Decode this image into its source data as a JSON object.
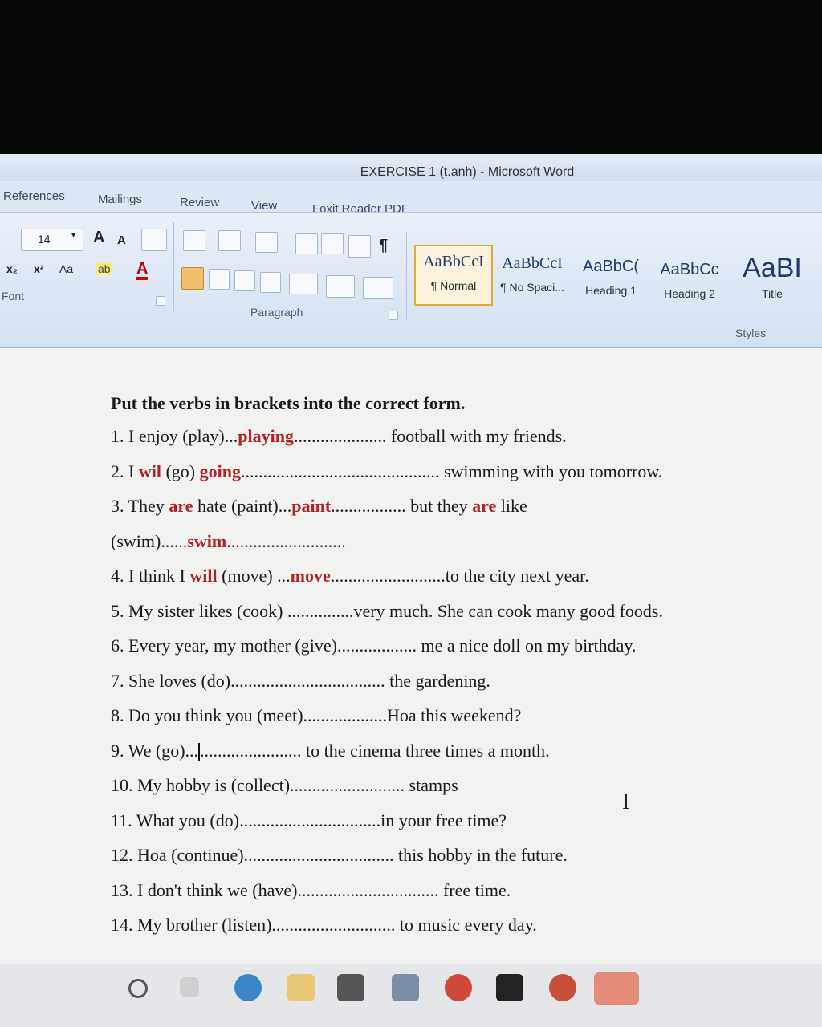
{
  "window": {
    "title": "EXERCISE 1 (t.anh) - Microsoft Word"
  },
  "tabs": [
    "References",
    "Mailings",
    "Review",
    "View",
    "Foxit Reader PDF"
  ],
  "ribbon": {
    "font_size": "14",
    "font_group_label": "Font",
    "paragraph_group_label": "Paragraph",
    "styles_group_label": "Styles",
    "styles": [
      {
        "sample": "AaBbCcI",
        "label": "¶ Normal"
      },
      {
        "sample": "AaBbCcI",
        "label": "¶ No Spaci..."
      },
      {
        "sample": "AaBbC(",
        "label": "Heading 1"
      },
      {
        "sample": "AaBbCc",
        "label": "Heading 2"
      },
      {
        "sample": "AaBI",
        "label": "Title"
      }
    ],
    "icons": {
      "grow_font": "A",
      "shrink_font": "A",
      "subscript": "x₂",
      "superscript": "x²",
      "change_case": "Aa",
      "highlight": "ab",
      "font_color": "A",
      "show_marks": "¶"
    }
  },
  "document": {
    "heading": "Put the verbs in brackets into the correct form.",
    "lines": [
      {
        "pre": "1. I enjoy (play)...",
        "ans": "playing",
        "post": "..................... football with my friends."
      },
      {
        "pre": "2. I ",
        "ans": "wil",
        "mid": " (go) ",
        "ans2": "going",
        "post": "............................................. swimming with you tomorrow."
      },
      {
        "pre": "3. They ",
        "ans": "are",
        "mid": " hate (paint)...",
        "ans2": "paint",
        "post": "................. but they ",
        "ans3": "are",
        "post2": " like"
      },
      {
        "pre": "(swim)......",
        "ans": "swim",
        "post": "..........................."
      },
      {
        "pre": "4. I think I ",
        "ans": "will",
        "mid": " (move) ...",
        "ans2": "move",
        "post": "..........................to the city next year."
      },
      {
        "pre": "5. My sister likes (cook) ...............very much. She can cook many good foods."
      },
      {
        "pre": "6. Every year, my mother (give).................. me a nice doll on my birthday."
      },
      {
        "pre": "7. She loves (do)................................... the gardening."
      },
      {
        "pre": "8. Do you think you (meet)...................Hoa this weekend?"
      },
      {
        "pre": "9. We (go)...",
        "caret": true,
        "post": "....................... to the cinema three times a month."
      },
      {
        "pre": "10. My hobby is (collect).......................... stamps"
      },
      {
        "pre": "11. What you (do)................................in your free time?"
      },
      {
        "pre": "12. Hoa (continue).................................. this hobby in the future."
      },
      {
        "pre": "13. I don't think we (have)................................ free time."
      },
      {
        "pre": "14. My brother (listen)............................ to music every day."
      }
    ]
  },
  "colors": {
    "answer": "#b22222",
    "ribbon": "#d3e0f0",
    "style_active": "#e3a83b"
  }
}
